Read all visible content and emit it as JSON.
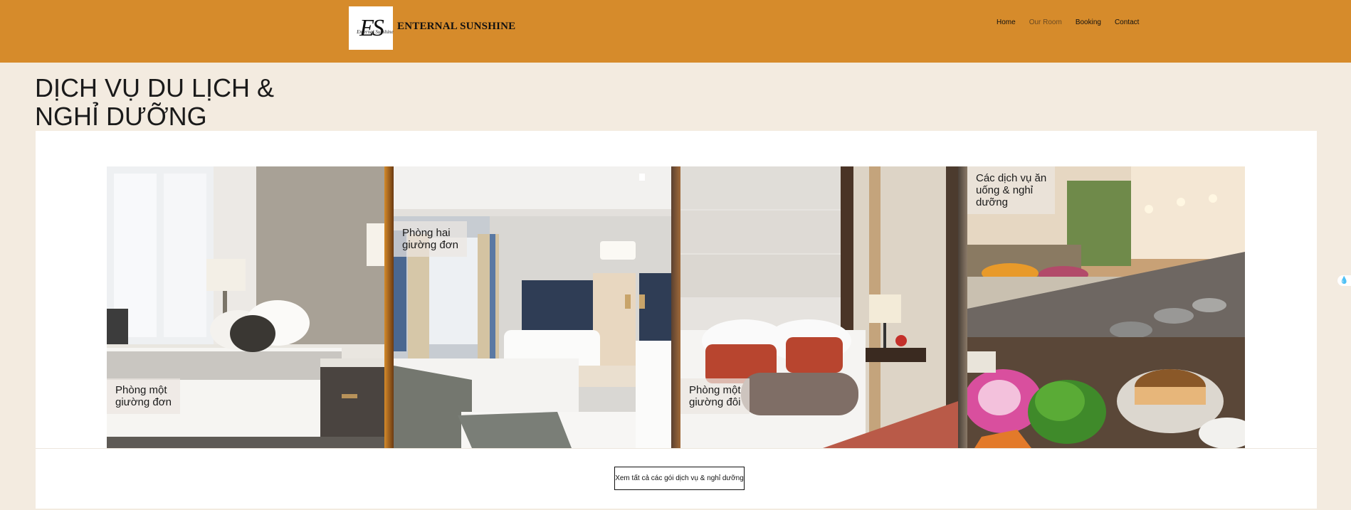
{
  "header": {
    "logo_letters": "ES",
    "logo_script": "Enternal Sunshine",
    "brand": "ENTERNAL SUNSHINE",
    "nav": [
      {
        "label": "Home",
        "active": false
      },
      {
        "label": "Our Room",
        "active": true
      },
      {
        "label": "Booking",
        "active": false
      },
      {
        "label": "Contact",
        "active": false
      }
    ]
  },
  "main": {
    "title_line1": "DỊCH VỤ DU LỊCH &",
    "title_line2": "NGHỈ DƯỠNG",
    "cards": [
      {
        "line1": "Phòng một",
        "line2": "giường đơn",
        "line3": ""
      },
      {
        "line1": "Phòng hai",
        "line2": "giường đơn",
        "line3": ""
      },
      {
        "line1": "Phòng một",
        "line2": "giường đôi",
        "line3": ""
      },
      {
        "line1": "Các dịch vụ ăn",
        "line2": "uống & nghỉ",
        "line3": "dưỡng"
      }
    ],
    "cta_label": "Xem tất cả các gói dịch vụ & nghỉ dưỡng"
  },
  "colors": {
    "header_bg": "#d68b2b",
    "page_bg": "#f3ebe0",
    "panel_bg": "#ffffff"
  }
}
